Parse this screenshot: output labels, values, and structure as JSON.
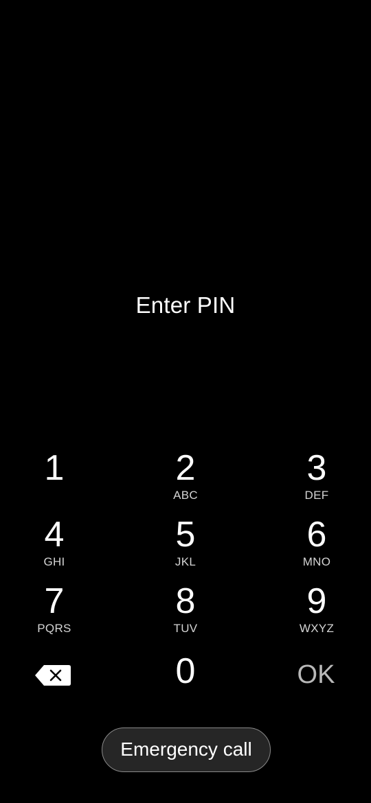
{
  "lockscreen": {
    "prompt": "Enter PIN"
  },
  "keypad": {
    "keys": [
      {
        "digit": "1",
        "letters": ""
      },
      {
        "digit": "2",
        "letters": "ABC"
      },
      {
        "digit": "3",
        "letters": "DEF"
      },
      {
        "digit": "4",
        "letters": "GHI"
      },
      {
        "digit": "5",
        "letters": "JKL"
      },
      {
        "digit": "6",
        "letters": "MNO"
      },
      {
        "digit": "7",
        "letters": "PQRS"
      },
      {
        "digit": "8",
        "letters": "TUV"
      },
      {
        "digit": "9",
        "letters": "WXYZ"
      },
      {
        "digit": "0",
        "letters": ""
      }
    ],
    "backspace_icon": "backspace-icon",
    "ok_label": "OK"
  },
  "emergency": {
    "label": "Emergency call"
  },
  "colors": {
    "background": "#000000",
    "text": "#ffffff",
    "ok_text": "#b8b8b8",
    "emergency_bg": "#262626",
    "emergency_border": "#8a8a8a"
  }
}
